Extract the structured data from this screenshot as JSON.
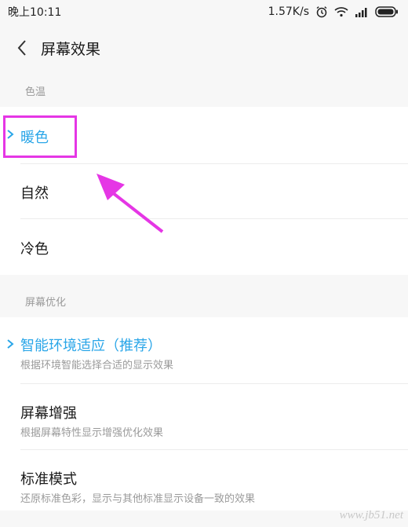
{
  "status": {
    "time": "晚上10:11",
    "speed": "1.57K/s"
  },
  "header": {
    "title": "屏幕效果"
  },
  "color_temp": {
    "section_label": "色温",
    "items": [
      {
        "label": "暖色",
        "selected": true
      },
      {
        "label": "自然",
        "selected": false
      },
      {
        "label": "冷色",
        "selected": false
      }
    ]
  },
  "optimization": {
    "section_label": "屏幕优化",
    "items": [
      {
        "label": "智能环境适应（推荐）",
        "sub": "根据环境智能选择合适的显示效果",
        "selected": true
      },
      {
        "label": "屏幕增强",
        "sub": "根据屏幕特性显示增强优化效果",
        "selected": false
      },
      {
        "label": "标准模式",
        "sub": "还原标准色彩，显示与其他标准显示设备一致的效果",
        "selected": false
      }
    ]
  },
  "watermark": "www.jb51.net",
  "colors": {
    "accent": "#2aa6e8",
    "annotation": "#e536e5"
  }
}
